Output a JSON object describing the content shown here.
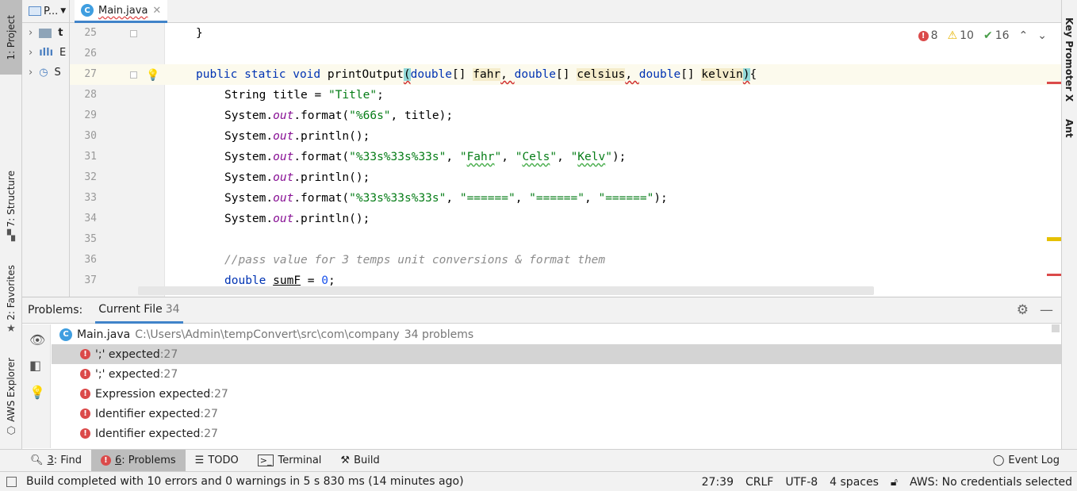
{
  "left_strip": {
    "project_tab": "1: Project",
    "structure_tab": "7: Structure",
    "favorites_tab": "2: Favorites",
    "aws_tab": "AWS Explorer"
  },
  "right_strip": {
    "key_promoter_tab": "Key Promoter X",
    "ant_tab": "Ant"
  },
  "project_panel": {
    "header_label": "P...",
    "rows": [
      "t",
      "E",
      "S"
    ]
  },
  "editor_tab": {
    "filename": "Main.java",
    "icon_letter": "C"
  },
  "inspections": {
    "errors": "8",
    "warnings": "10",
    "weak_warnings": "16"
  },
  "editor": {
    "current_line": "27",
    "line_numbers": [
      "25",
      "26",
      "27",
      "28",
      "29",
      "30",
      "31",
      "32",
      "33",
      "34",
      "35",
      "36",
      "37"
    ],
    "code": {
      "l25": "}",
      "l27_kw": "public static void",
      "l27_fn": "printOutput",
      "l27_paren_open": "(",
      "l27_type1": "double",
      "l27_arr1": "[] ",
      "l27_p1": "fahr",
      "l27_type2": "double",
      "l27_arr2": "[] ",
      "l27_p2": "celsius",
      "l27_type3": "double",
      "l27_arr3": "[] ",
      "l27_p3": "kelvin",
      "l27_paren_close": ")",
      "l27_brace": "{",
      "l28_type": "String title = ",
      "l28_str": "\"Title\"",
      "l29_a": "System.",
      "l29_out": "out",
      "l29_b": ".format(",
      "l29_str": "\"%66s\"",
      "l29_c": ", title);",
      "l30_a": "System.",
      "l30_out": "out",
      "l30_b": ".println();",
      "l31_a": "System.",
      "l31_out": "out",
      "l31_b": ".format(",
      "l31_fmt": "\"%33s%33s%33s\"",
      "l31_c": ", ",
      "l31_s1q": "\"",
      "l31_s1": "Fahr",
      "l31_s2": "Cels",
      "l31_s3": "Kelv",
      "l31_end": ");",
      "l32_a": "System.",
      "l32_out": "out",
      "l32_b": ".println();",
      "l33_a": "System.",
      "l33_out": "out",
      "l33_b": ".format(",
      "l33_fmt": "\"%33s%33s%33s\"",
      "l33_s1": "\"======\"",
      "l33_s2": "\"======\"",
      "l33_s3": "\"======\"",
      "l33_end": ");",
      "l34_a": "System.",
      "l34_out": "out",
      "l34_b": ".println();",
      "l36_comment": "//pass value for 3 temps unit conversions & format them",
      "l37_kw": "double",
      "l37_var": "sumF",
      "l37_eq": " = ",
      "l37_num": "0",
      "l37_end": ";"
    }
  },
  "problems_panel": {
    "title": "Problems:",
    "tab_label": "Current File",
    "tab_count": "34",
    "file": {
      "name": "Main.java",
      "path": "C:\\Users\\Admin\\tempConvert\\src\\com\\company",
      "count": "34 problems"
    },
    "items": [
      {
        "text": "';' expected",
        "line": ":27"
      },
      {
        "text": "';' expected",
        "line": ":27"
      },
      {
        "text": "Expression expected",
        "line": ":27"
      },
      {
        "text": "Identifier expected",
        "line": ":27"
      },
      {
        "text": "Identifier expected",
        "line": ":27"
      }
    ]
  },
  "bottom_tabs": {
    "find_num": "3",
    "find_label": ": Find",
    "problems_num": "6",
    "problems_label": ": Problems",
    "todo": "TODO",
    "terminal": "Terminal",
    "build": "Build",
    "event_log": "Event Log"
  },
  "status": {
    "message": "Build completed with 10 errors and 0 warnings in 5 s 830 ms (14 minutes ago)",
    "position": "27:39",
    "line_sep": "CRLF",
    "encoding": "UTF-8",
    "indent": "4 spaces",
    "aws": "AWS: No credentials selected"
  },
  "colors": {
    "accent": "#4083c9",
    "error": "#db4a4a",
    "warning": "#e6b400",
    "keyword": "#0033b3",
    "string": "#067d17"
  }
}
